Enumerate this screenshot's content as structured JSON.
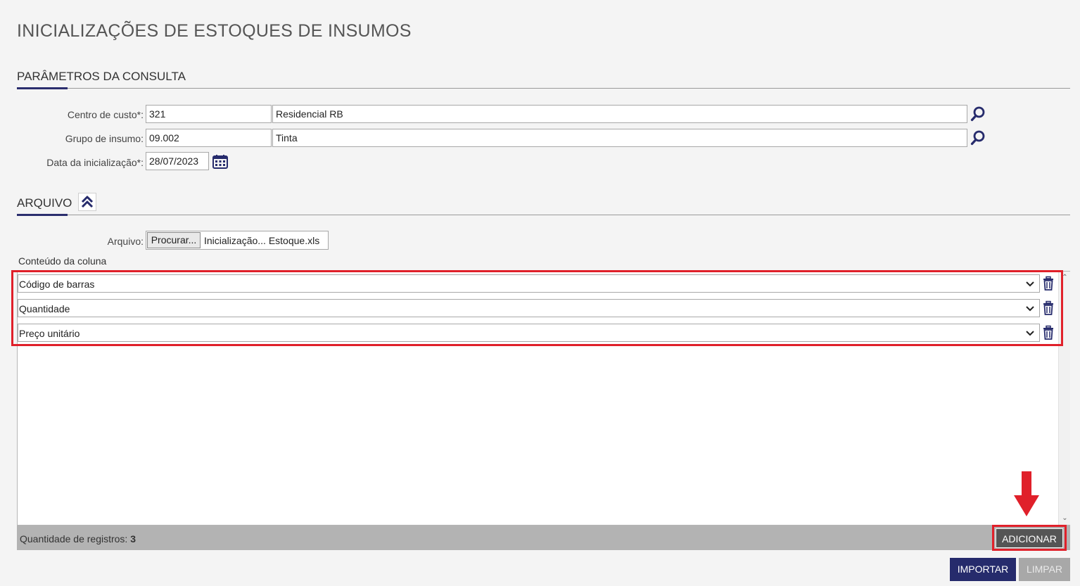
{
  "page": {
    "title": "INICIALIZAÇÕES DE ESTOQUES DE INSUMOS"
  },
  "params_section": {
    "title": "PARÂMETROS DA CONSULTA",
    "centro_custo": {
      "label": "Centro de custo*:",
      "code": "321",
      "name": "Residencial RB"
    },
    "grupo_insumo": {
      "label": "Grupo de insumo:",
      "code": "09.002",
      "name": "Tinta"
    },
    "data_inicializacao": {
      "label": "Data da inicialização*:",
      "value": "28/07/2023"
    }
  },
  "arquivo_section": {
    "title": "ARQUIVO",
    "file_label": "Arquivo:",
    "browse_label": "Procurar...",
    "file_name": "Inicialização... Estoque.xls",
    "column_caption": "Conteúdo da coluna",
    "columns": [
      {
        "value": "Código de barras"
      },
      {
        "value": "Quantidade"
      },
      {
        "value": "Preço unitário"
      }
    ]
  },
  "footer": {
    "count_label": "Quantidade de registros:",
    "count_value": "3",
    "add_label": "ADICIONAR"
  },
  "actions": {
    "import_label": "IMPORTAR",
    "clear_label": "LIMPAR"
  },
  "colors": {
    "accent": "#2b2e6e",
    "primary_button": "#262b6c",
    "disabled_button": "#a8a8a8",
    "highlight": "#e0202a",
    "footer_bar": "#b3b3b3"
  },
  "icons": {
    "search": "search-icon",
    "calendar": "calendar-icon",
    "collapse": "double-chevron-up-icon",
    "dropdown": "chevron-down-icon",
    "delete": "trash-icon",
    "annotation": "red-arrow-down-icon"
  }
}
